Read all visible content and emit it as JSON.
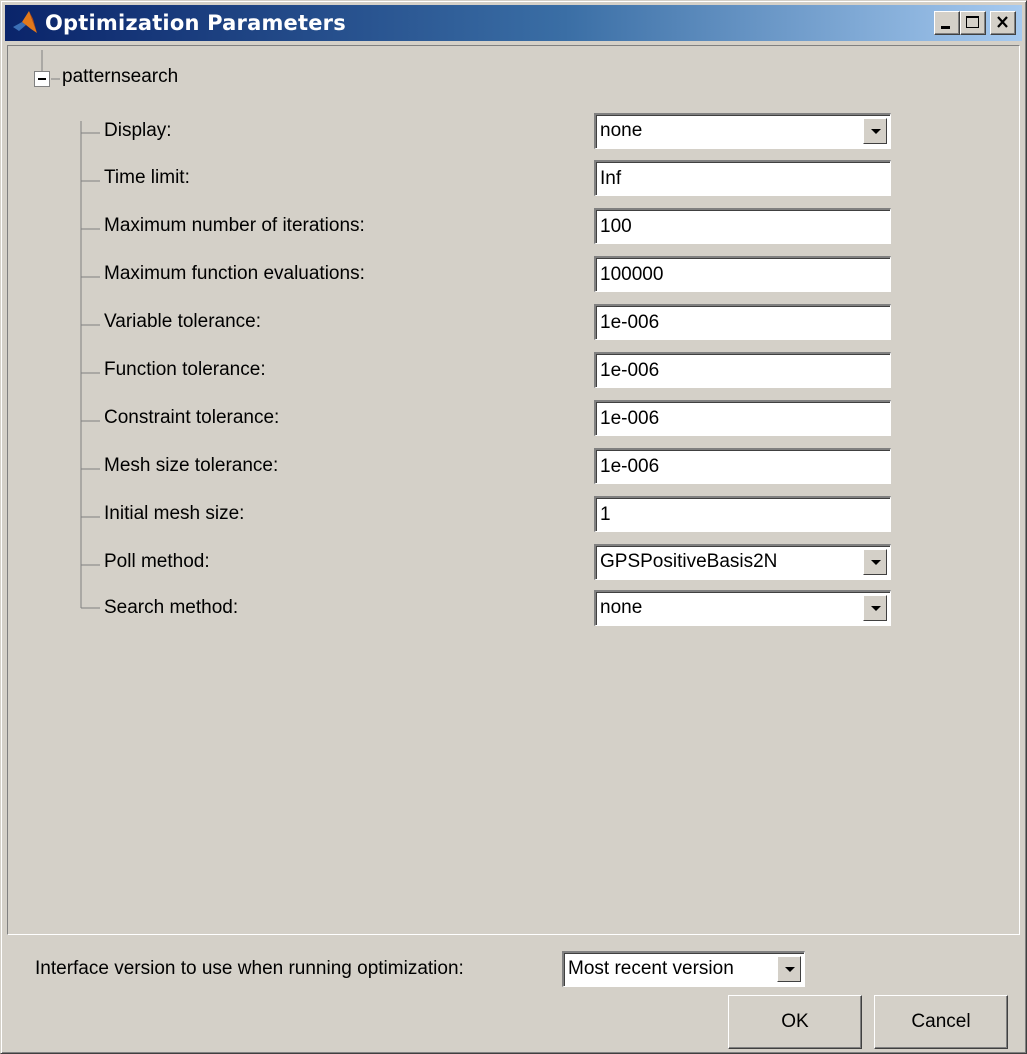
{
  "window": {
    "title": "Optimization Parameters",
    "app_icon": "matlab-logo-icon",
    "controls": [
      "minimize-icon",
      "maximize-icon",
      "close-icon"
    ]
  },
  "tree": {
    "root_label": "patternsearch",
    "toggle_icon": "collapse-minus-icon",
    "params": [
      {
        "label": "Display:",
        "type": "select",
        "value": "none"
      },
      {
        "label": "Time limit:",
        "type": "text",
        "value": "Inf"
      },
      {
        "label": "Maximum number of iterations:",
        "type": "text",
        "value": "100"
      },
      {
        "label": "Maximum function evaluations:",
        "type": "text",
        "value": "100000"
      },
      {
        "label": "Variable tolerance:",
        "type": "text",
        "value": "1e-006"
      },
      {
        "label": "Function tolerance:",
        "type": "text",
        "value": "1e-006"
      },
      {
        "label": "Constraint tolerance:",
        "type": "text",
        "value": "1e-006"
      },
      {
        "label": "Mesh size tolerance:",
        "type": "text",
        "value": "1e-006"
      },
      {
        "label": "Initial mesh size:",
        "type": "text",
        "value": "1"
      },
      {
        "label": "Poll method:",
        "type": "select",
        "value": "GPSPositiveBasis2N"
      },
      {
        "label": "Search method:",
        "type": "select",
        "value": "none"
      }
    ]
  },
  "footer": {
    "interface_label": "Interface version to use when running optimization:",
    "interface_value": "Most recent version",
    "ok_label": "OK",
    "cancel_label": "Cancel"
  },
  "colors": {
    "titlebar_start": "#0a246a",
    "titlebar_end": "#a6caf0",
    "face": "#d4d0c8"
  }
}
